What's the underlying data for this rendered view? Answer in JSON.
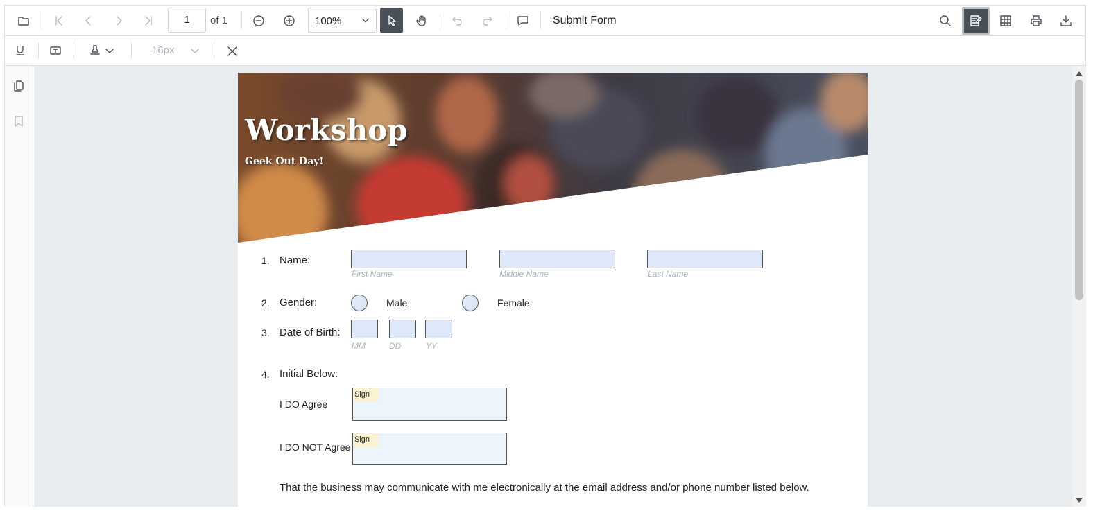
{
  "toolbar": {
    "page_current": "1",
    "page_of": "of 1",
    "zoom_value": "100%",
    "submit_label": "Submit Form"
  },
  "annot_toolbar": {
    "font_size": "16px"
  },
  "document": {
    "title": "Workshop",
    "subtitle": "Geek Out Day!",
    "q1": {
      "num": "1.",
      "label": "Name:",
      "hints": [
        "First Name",
        "Middle Name",
        "Last Name"
      ]
    },
    "q2": {
      "num": "2.",
      "label": "Gender:",
      "options": [
        "Male",
        "Female"
      ]
    },
    "q3": {
      "num": "3.",
      "label": "Date of Birth:",
      "hints": [
        "MM",
        "DD",
        "YY"
      ]
    },
    "q4": {
      "num": "4.",
      "label": "Initial Below:",
      "agree": "I DO Agree",
      "disagree": "I DO NOT Agree",
      "sign_tag": "Sign"
    },
    "consent_text": "That the business may communicate with me electronically at the email address and/or phone number listed below."
  },
  "colors": {
    "field_fill": "#dde9f8",
    "sign_fill": "#eef4fc",
    "sign_tag": "#fbf2d3",
    "active_tool": "#495057"
  }
}
